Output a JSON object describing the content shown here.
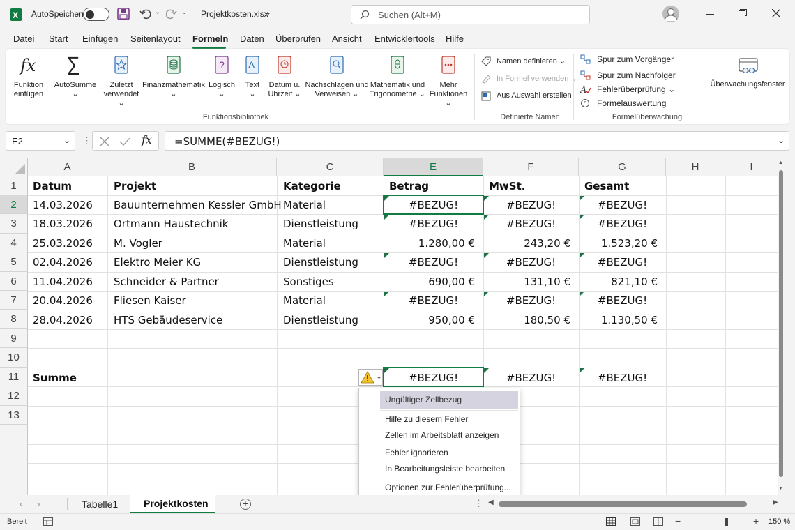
{
  "title_bar": {
    "autosave_label": "AutoSpeichern",
    "file_name": "Projektkosten.xlsx",
    "search_placeholder": "Suchen (Alt+M)"
  },
  "menu": [
    "Datei",
    "Start",
    "Einfügen",
    "Seitenlayout",
    "Formeln",
    "Daten",
    "Überprüfen",
    "Ansicht",
    "Entwicklertools",
    "Hilfe"
  ],
  "menu_active": "Formeln",
  "ribbon": {
    "function_library": {
      "group_label": "Funktionsbibliothek",
      "buttons": [
        {
          "line1": "Funktion",
          "line2": "einfügen",
          "icon": "fx-icon"
        },
        {
          "line1": "AutoSumme",
          "line2": "⌄",
          "icon": "sigma-icon"
        },
        {
          "line1": "Zuletzt",
          "line2": "verwendet ⌄",
          "icon": "star-icon"
        },
        {
          "line1": "Finanzmathematik",
          "line2": "⌄",
          "icon": "database-icon"
        },
        {
          "line1": "Logisch",
          "line2": "⌄",
          "icon": "question-book-icon"
        },
        {
          "line1": "Text",
          "line2": "⌄",
          "icon": "text-book-icon"
        },
        {
          "line1": "Datum u.",
          "line2": "Uhrzeit ⌄",
          "icon": "clock-book-icon"
        },
        {
          "line1": "Nachschlagen und",
          "line2": "Verweisen ⌄",
          "icon": "magnifier-book-icon"
        },
        {
          "line1": "Mathematik und",
          "line2": "Trigonometrie ⌄",
          "icon": "theta-book-icon"
        },
        {
          "line1": "Mehr",
          "line2": "Funktionen ⌄",
          "icon": "more-book-icon"
        }
      ]
    },
    "defined_names": {
      "group_label": "Definierte Namen",
      "items": [
        "Namen definieren ⌄",
        "In Formel verwenden ⌄",
        "Aus Auswahl erstellen"
      ]
    },
    "formula_auditing": {
      "group_label": "Formelüberwachung",
      "items": [
        "Spur zum Vorgänger",
        "Spur zum Nachfolger",
        "Fehlerüberprüfung ⌄",
        "Formelauswertung"
      ],
      "watch_window": "Überwachungsfenster"
    }
  },
  "formula_bar": {
    "name_box": "E2",
    "formula": "=SUMME(#BEZUG!)"
  },
  "columns": [
    "A",
    "B",
    "C",
    "E",
    "F",
    "G",
    "H",
    "I"
  ],
  "rows": [
    "1",
    "2",
    "3",
    "4",
    "5",
    "6",
    "7",
    "8",
    "9",
    "10",
    "11",
    "12",
    "13"
  ],
  "table": {
    "headers": [
      "Datum",
      "Projekt",
      "Kategorie",
      "Betrag",
      "MwSt.",
      "Gesamt"
    ],
    "data": [
      [
        "14.03.2026",
        "Bauunternehmen Kessler GmbH",
        "Material",
        "#BEZUG!",
        "#BEZUG!",
        "#BEZUG!"
      ],
      [
        "18.03.2026",
        "Ortmann Haustechnik",
        "Dienstleistung",
        "#BEZUG!",
        "#BEZUG!",
        "#BEZUG!"
      ],
      [
        "25.03.2026",
        "M. Vogler",
        "Material",
        "1.280,00 €",
        "243,20 €",
        "1.523,20 €"
      ],
      [
        "02.04.2026",
        "Elektro Meier KG",
        "Dienstleistung",
        "#BEZUG!",
        "#BEZUG!",
        "#BEZUG!"
      ],
      [
        "11.04.2026",
        "Schneider & Partner",
        "Sonstiges",
        "690,00 €",
        "131,10 €",
        "821,10 €"
      ],
      [
        "20.04.2026",
        "Fliesen Kaiser",
        "Material",
        "#BEZUG!",
        "#BEZUG!",
        "#BEZUG!"
      ],
      [
        "28.04.2026",
        "HTS Gebäudeservice",
        "Dienstleistung",
        "950,00 €",
        "180,50 €",
        "1.130,50 €"
      ]
    ],
    "sum_label": "Summe",
    "sum_values": [
      "#BEZUG!",
      "#BEZUG!",
      "#BEZUG!"
    ]
  },
  "error_menu": {
    "items": [
      "Ungültiger Zellbezug",
      "Hilfe zu diesem Fehler",
      "Zellen im Arbeitsblatt anzeigen",
      "Fehler ignorieren",
      "In Bearbeitungsleiste bearbeiten",
      "Optionen zur Fehlerüberprüfung..."
    ]
  },
  "sheet_tabs": [
    "Tabelle1",
    "Projektkosten"
  ],
  "active_sheet": "Projektkosten",
  "status": {
    "ready": "Bereit",
    "zoom": "150 %"
  },
  "colors": {
    "excel_green": "#107c41",
    "error_triangle": "#1e7145",
    "warning_yellow": "#f4c430"
  }
}
